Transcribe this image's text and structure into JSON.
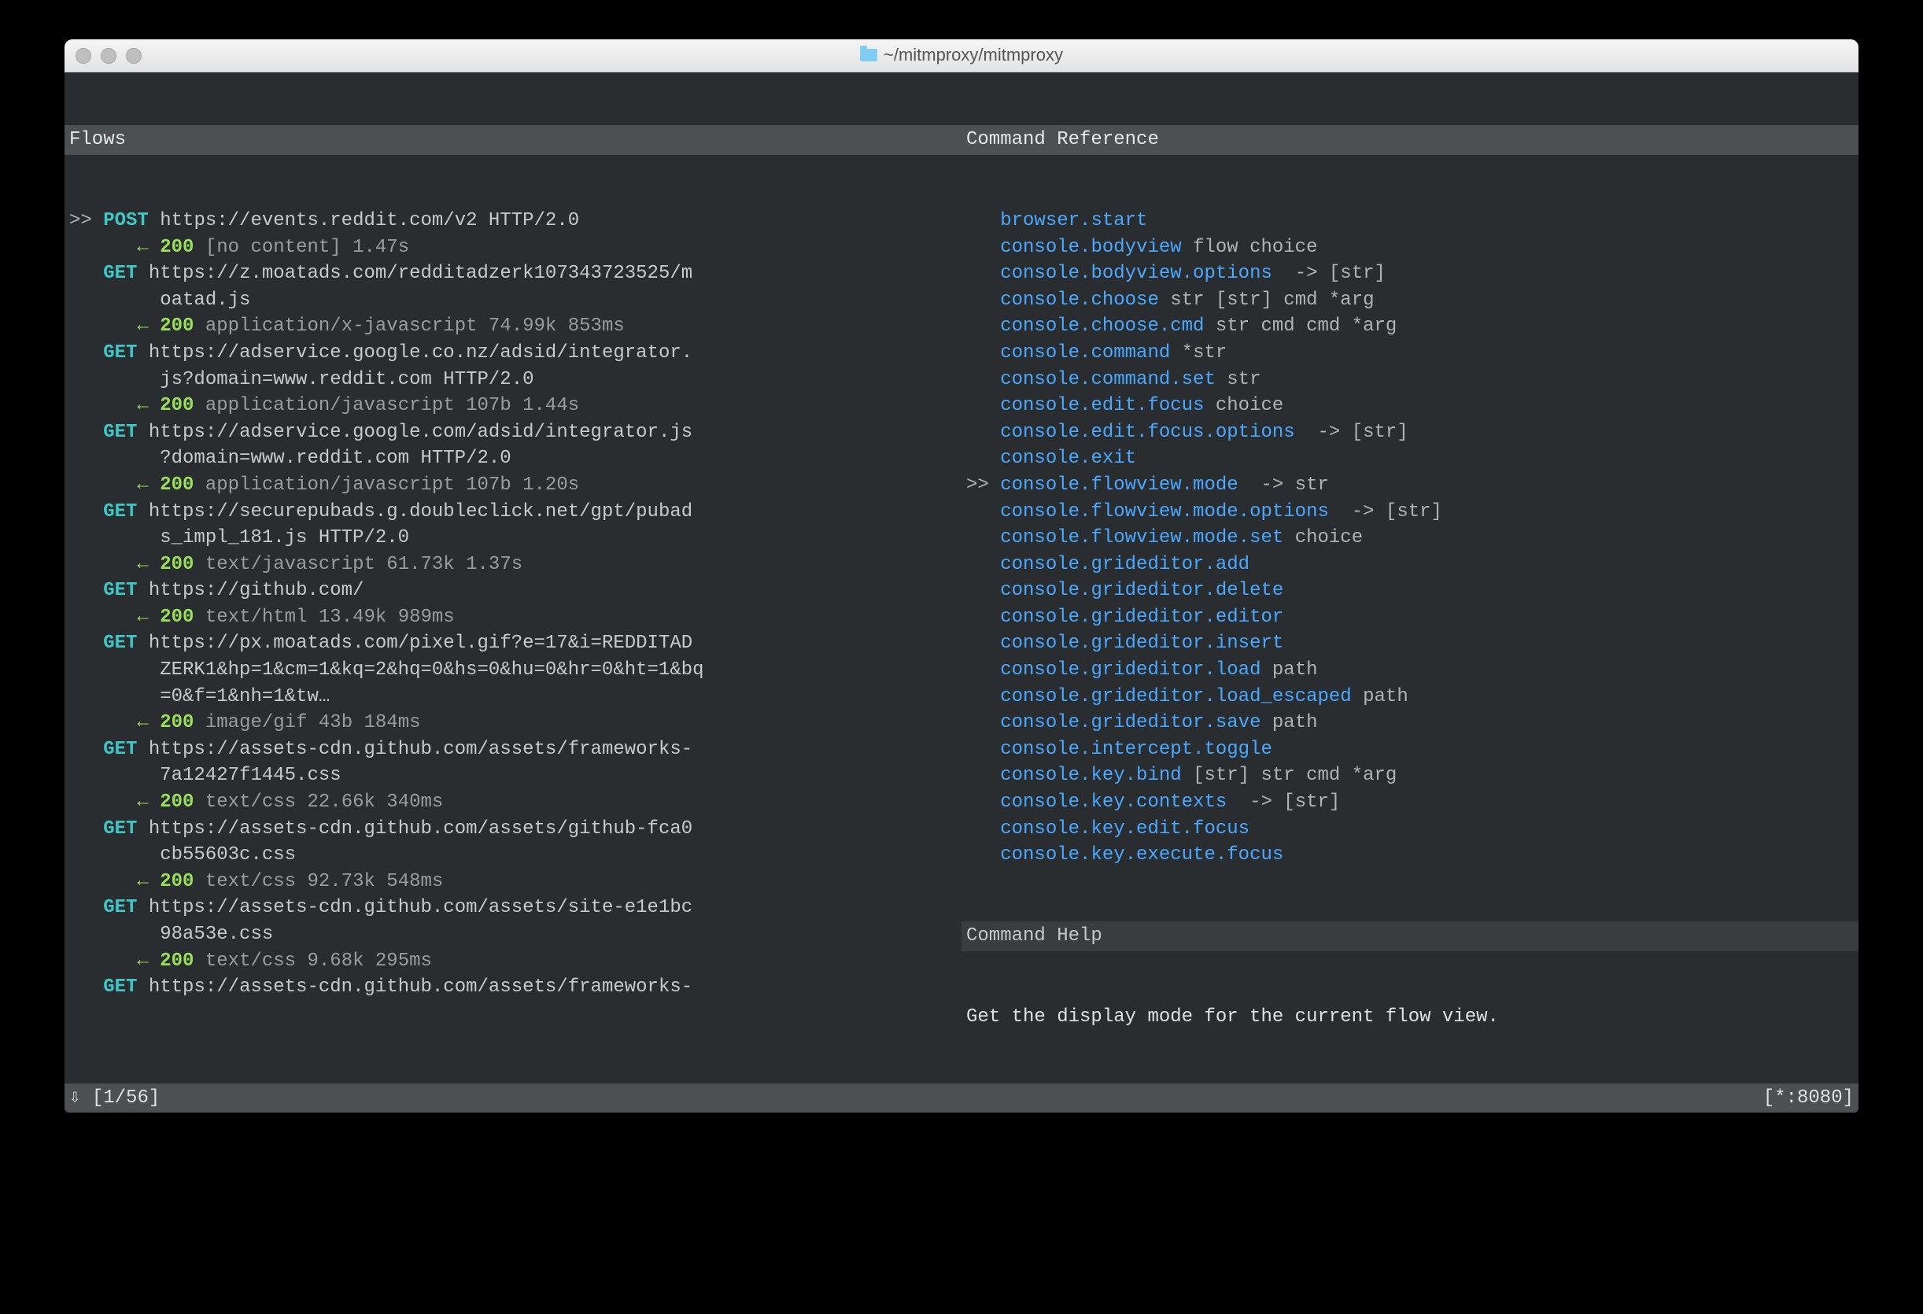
{
  "window": {
    "title": "~/mitmproxy/mitmproxy"
  },
  "headers": {
    "flows": "Flows",
    "command_ref": "Command Reference",
    "command_help": "Command Help"
  },
  "help_text": "Get the display mode for the current flow view.",
  "status": {
    "left": "⇩ [1/56]",
    "right": "[*:8080]"
  },
  "flows": [
    {
      "selected": true,
      "method": "POST",
      "url": "https://events.reddit.com/v2 HTTP/2.0",
      "url_cont": [],
      "resp_code": "200",
      "resp_meta": "[no content] 1.47s"
    },
    {
      "selected": false,
      "method": "GET",
      "url": "https://z.moatads.com/redditadzerk107343723525/m",
      "url_cont": [
        "oatad.js"
      ],
      "resp_code": "200",
      "resp_meta": "application/x-javascript 74.99k 853ms"
    },
    {
      "selected": false,
      "method": "GET",
      "url": "https://adservice.google.co.nz/adsid/integrator.",
      "url_cont": [
        "js?domain=www.reddit.com HTTP/2.0"
      ],
      "resp_code": "200",
      "resp_meta": "application/javascript 107b 1.44s"
    },
    {
      "selected": false,
      "method": "GET",
      "url": "https://adservice.google.com/adsid/integrator.js",
      "url_cont": [
        "?domain=www.reddit.com HTTP/2.0"
      ],
      "resp_code": "200",
      "resp_meta": "application/javascript 107b 1.20s"
    },
    {
      "selected": false,
      "method": "GET",
      "url": "https://securepubads.g.doubleclick.net/gpt/pubad",
      "url_cont": [
        "s_impl_181.js HTTP/2.0"
      ],
      "resp_code": "200",
      "resp_meta": "text/javascript 61.73k 1.37s"
    },
    {
      "selected": false,
      "method": "GET",
      "url": "https://github.com/",
      "url_cont": [],
      "resp_code": "200",
      "resp_meta": "text/html 13.49k 989ms"
    },
    {
      "selected": false,
      "method": "GET",
      "url": "https://px.moatads.com/pixel.gif?e=17&i=REDDITAD",
      "url_cont": [
        "ZERK1&hp=1&cm=1&kq=2&hq=0&hs=0&hu=0&hr=0&ht=1&bq",
        "=0&f=1&nh=1&tw…"
      ],
      "resp_code": "200",
      "resp_meta": "image/gif 43b 184ms"
    },
    {
      "selected": false,
      "method": "GET",
      "url": "https://assets-cdn.github.com/assets/frameworks-",
      "url_cont": [
        "7a12427f1445.css"
      ],
      "resp_code": "200",
      "resp_meta": "text/css 22.66k 340ms"
    },
    {
      "selected": false,
      "method": "GET",
      "url": "https://assets-cdn.github.com/assets/github-fca0",
      "url_cont": [
        "cb55603c.css"
      ],
      "resp_code": "200",
      "resp_meta": "text/css 92.73k 548ms"
    },
    {
      "selected": false,
      "method": "GET",
      "url": "https://assets-cdn.github.com/assets/site-e1e1bc",
      "url_cont": [
        "98a53e.css"
      ],
      "resp_code": "200",
      "resp_meta": "text/css 9.68k 295ms"
    },
    {
      "selected": false,
      "method": "GET",
      "url": "https://assets-cdn.github.com/assets/frameworks-",
      "url_cont": [],
      "resp_code": "",
      "resp_meta": ""
    }
  ],
  "commands": [
    {
      "selected": false,
      "name": "browser.start",
      "args": "",
      "ret": ""
    },
    {
      "selected": false,
      "name": "console.bodyview",
      "args": "flow choice",
      "ret": ""
    },
    {
      "selected": false,
      "name": "console.bodyview.options",
      "args": "",
      "ret": "-> [str]"
    },
    {
      "selected": false,
      "name": "console.choose",
      "args": "str [str] cmd *arg",
      "ret": ""
    },
    {
      "selected": false,
      "name": "console.choose.cmd",
      "args": "str cmd cmd *arg",
      "ret": ""
    },
    {
      "selected": false,
      "name": "console.command",
      "args": "*str",
      "ret": ""
    },
    {
      "selected": false,
      "name": "console.command.set",
      "args": "str",
      "ret": ""
    },
    {
      "selected": false,
      "name": "console.edit.focus",
      "args": "choice",
      "ret": ""
    },
    {
      "selected": false,
      "name": "console.edit.focus.options",
      "args": "",
      "ret": "-> [str]"
    },
    {
      "selected": false,
      "name": "console.exit",
      "args": "",
      "ret": ""
    },
    {
      "selected": true,
      "name": "console.flowview.mode",
      "args": "",
      "ret": "-> str"
    },
    {
      "selected": false,
      "name": "console.flowview.mode.options",
      "args": "",
      "ret": "-> [str]"
    },
    {
      "selected": false,
      "name": "console.flowview.mode.set",
      "args": "choice",
      "ret": ""
    },
    {
      "selected": false,
      "name": "console.grideditor.add",
      "args": "",
      "ret": ""
    },
    {
      "selected": false,
      "name": "console.grideditor.delete",
      "args": "",
      "ret": ""
    },
    {
      "selected": false,
      "name": "console.grideditor.editor",
      "args": "",
      "ret": ""
    },
    {
      "selected": false,
      "name": "console.grideditor.insert",
      "args": "",
      "ret": ""
    },
    {
      "selected": false,
      "name": "console.grideditor.load",
      "args": "path",
      "ret": ""
    },
    {
      "selected": false,
      "name": "console.grideditor.load_escaped",
      "args": "path",
      "ret": ""
    },
    {
      "selected": false,
      "name": "console.grideditor.save",
      "args": "path",
      "ret": ""
    },
    {
      "selected": false,
      "name": "console.intercept.toggle",
      "args": "",
      "ret": ""
    },
    {
      "selected": false,
      "name": "console.key.bind",
      "args": "[str] str cmd *arg",
      "ret": ""
    },
    {
      "selected": false,
      "name": "console.key.contexts",
      "args": "",
      "ret": "-> [str]"
    },
    {
      "selected": false,
      "name": "console.key.edit.focus",
      "args": "",
      "ret": ""
    },
    {
      "selected": false,
      "name": "console.key.execute.focus",
      "args": "",
      "ret": ""
    }
  ]
}
